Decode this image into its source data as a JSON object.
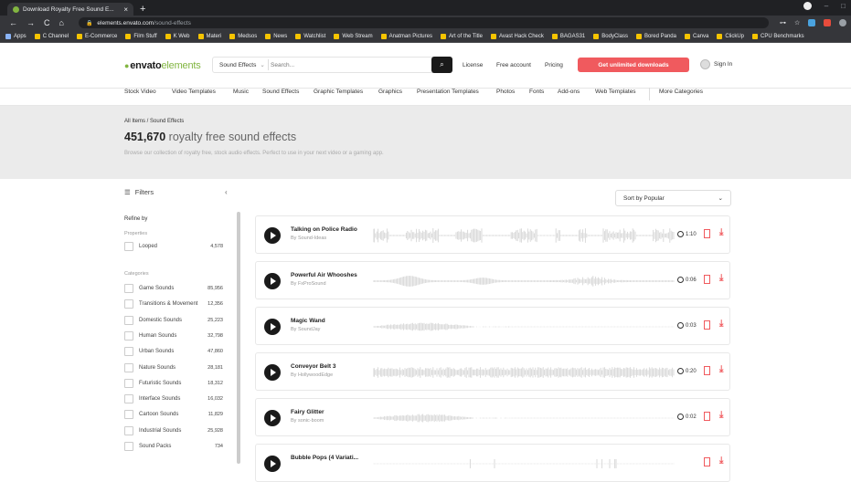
{
  "browser": {
    "tab_title": "Download Royalty Free Sound E...",
    "tab_close": "×",
    "new_tab": "+",
    "url_domain": "elements.envato.com",
    "url_path": "/sound-effects",
    "nav_back": "←",
    "nav_forward": "→",
    "nav_reload": "C",
    "nav_home": "⌂",
    "lock": "🔒",
    "bookmarks": [
      "Apps",
      "C Channel",
      "E-Commerce",
      "Film Stuff",
      "K Web",
      "Materi",
      "Medsos",
      "News",
      "Watchlist",
      "Web Stream",
      "Anatman Pictures",
      "Art of the Title",
      "Avast Hack Check",
      "BAGAS31",
      "BodyClass",
      "Bored Panda",
      "Canva",
      "ClickUp",
      "CPU Benchmarks"
    ]
  },
  "header": {
    "logo_bold": "envato",
    "logo_light": "elements",
    "search_category": "Sound Effects",
    "search_placeholder": "Search...",
    "search_icon": "⌕",
    "links": [
      "License",
      "Free account",
      "Pricing"
    ],
    "cta": "Get unlimited downloads",
    "sign_in": "Sign In"
  },
  "categories": [
    "Stock Video",
    "Video Templates",
    "Music",
    "Sound Effects",
    "Graphic Templates",
    "Graphics",
    "Presentation Templates",
    "Photos",
    "Fonts",
    "Add-ons",
    "Web Templates",
    "More Categories"
  ],
  "hero": {
    "breadcrumb": "All Items / Sound Effects",
    "count": "451,670",
    "title_rest": "royalty free sound effects",
    "description": "Browse our collection of royalty free, stock audio effects. Perfect to use in your next video or a gaming app."
  },
  "filters": {
    "title": "Filters",
    "collapse": "‹",
    "refine": "Refine by",
    "properties": "Properties",
    "property_items": [
      {
        "label": "Looped",
        "count": "4,578"
      }
    ],
    "categories_label": "Categories",
    "category_items": [
      {
        "label": "Game Sounds",
        "count": "85,956"
      },
      {
        "label": "Transitions & Movement",
        "count": "12,356"
      },
      {
        "label": "Domestic Sounds",
        "count": "25,223"
      },
      {
        "label": "Human Sounds",
        "count": "32,798"
      },
      {
        "label": "Urban Sounds",
        "count": "47,860"
      },
      {
        "label": "Nature Sounds",
        "count": "28,181"
      },
      {
        "label": "Futuristic Sounds",
        "count": "18,312"
      },
      {
        "label": "Interface Sounds",
        "count": "16,032"
      },
      {
        "label": "Cartoon Sounds",
        "count": "11,829"
      },
      {
        "label": "Industrial Sounds",
        "count": "25,928"
      },
      {
        "label": "Sound Packs",
        "count": "734"
      }
    ]
  },
  "sort": {
    "label": "Sort by Popular",
    "chevron": "⌄"
  },
  "results": [
    {
      "title": "Talking on Police Radio",
      "author": "By Sound-Ideas",
      "duration": "1:10",
      "wave": "choppy"
    },
    {
      "title": "Powerful Air Whooshes",
      "author": "By FxProSound",
      "duration": "0:06",
      "wave": "whoosh"
    },
    {
      "title": "Magic Wand",
      "author": "By SoundJay",
      "duration": "0:03",
      "wave": "short"
    },
    {
      "title": "Conveyor Belt 3",
      "author": "By HollywoodEdge",
      "duration": "0:20",
      "wave": "steady"
    },
    {
      "title": "Fairy Glitter",
      "author": "By sonic-boom",
      "duration": "0:02",
      "wave": "short"
    },
    {
      "title": "Bubble Pops (4 Variati...",
      "author": "",
      "duration": "",
      "wave": "sparse"
    }
  ],
  "colors": {
    "accent": "#f05a5e",
    "brand_green": "#82b541",
    "play": "#1a1a1a",
    "wave": "#d6d6d6"
  }
}
